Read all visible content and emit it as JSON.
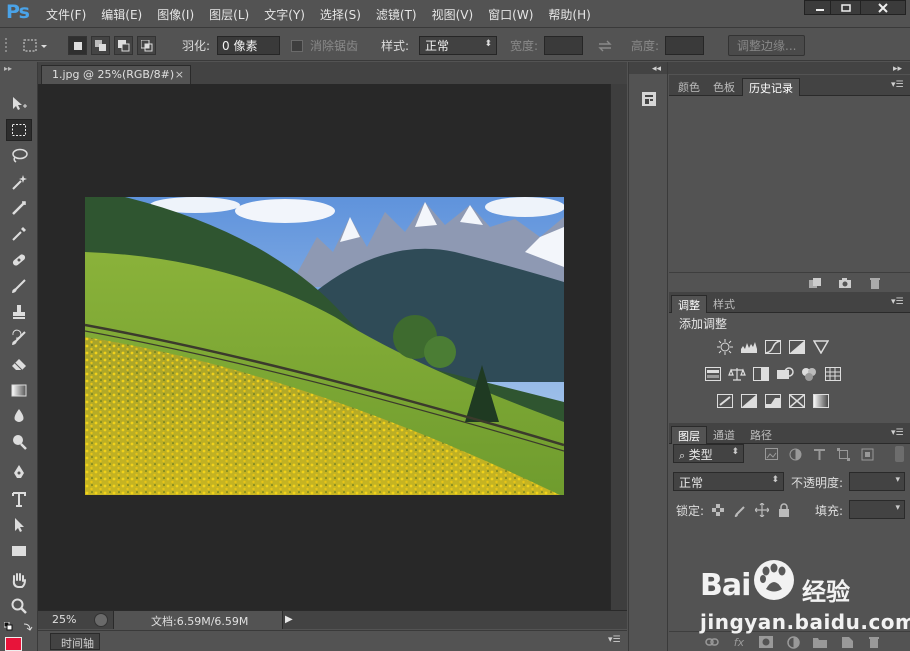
{
  "app": {
    "logo": "Ps"
  },
  "menu": [
    "文件(F)",
    "编辑(E)",
    "图像(I)",
    "图层(L)",
    "文字(Y)",
    "选择(S)",
    "滤镜(T)",
    "视图(V)",
    "窗口(W)",
    "帮助(H)"
  ],
  "options": {
    "feather_label": "羽化:",
    "feather_value": "0 像素",
    "antialias_label": "消除锯齿",
    "style_label": "样式:",
    "style_value": "正常",
    "width_label": "宽度:",
    "height_label": "高度:",
    "refine_edge_button": "调整边缘..."
  },
  "document": {
    "tab_title": "1.jpg @ 25%(RGB/8#)",
    "close_glyph": "×",
    "zoom": "25%",
    "doc_size": "文档:6.59M/6.59M",
    "timeline_tab": "时间轴",
    "photo_description_icon": "photo-mountain-meadow"
  },
  "panels": {
    "top_tabs": [
      "颜色",
      "色板",
      "历史记录"
    ],
    "top_active": 2,
    "adjust_tabs": [
      "调整",
      "样式"
    ],
    "adjust_active": 0,
    "adjust_title": "添加调整",
    "layers_tabs": [
      "图层",
      "通道",
      "路径"
    ],
    "layers_active": 0,
    "filter_kind": "类型",
    "blend_mode": "正常",
    "opacity_label": "不透明度:",
    "lock_label": "锁定:",
    "fill_label": "填充:"
  },
  "watermark": {
    "brand_left": "Bai",
    "brand_right": "经验",
    "url": "jingyan.baidu.com"
  },
  "colors": {
    "foreground": "#e8143a",
    "ps_blue": "#4aa3e8",
    "ui_gray": "#535353",
    "canvas_bg": "#282828"
  }
}
